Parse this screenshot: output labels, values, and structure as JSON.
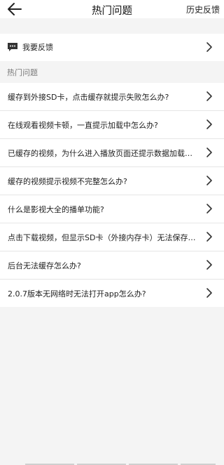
{
  "header": {
    "title": "热门问题",
    "history_label": "历史反馈"
  },
  "feedback": {
    "label": "我要反馈"
  },
  "section": {
    "label": "热门问题"
  },
  "questions": [
    "缓存到外接SD卡，点击缓存就提示失败怎么办?",
    "在线观看视频卡顿，一直提示加载中怎么办?",
    "已缓存的视频，为什么进入播放页面还提示数据加载…",
    "缓存的视频提示视频不完整怎么办?",
    "什么是影视大全的播单功能?",
    "点击下载视频，但显示SD卡（外接内存卡）无法保存…",
    "后台无法缓存怎么办?",
    "2.0.7版本无网络时无法打开app怎么办?"
  ],
  "icons": {
    "back": "back-arrow-icon",
    "feedback": "message-icon",
    "chevron": "chevron-right-icon"
  }
}
